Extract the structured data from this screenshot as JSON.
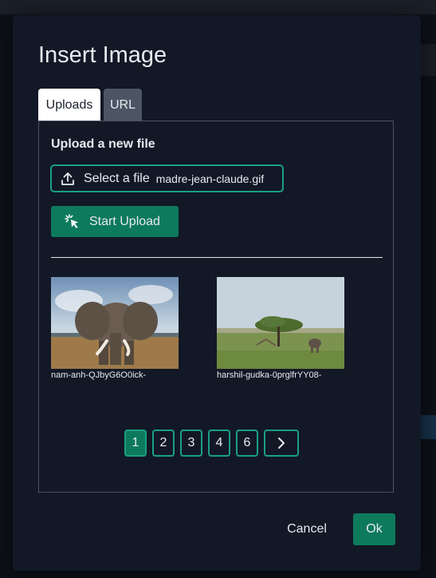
{
  "dialog": {
    "title": "Insert Image",
    "tabs": [
      {
        "label": "Uploads",
        "active": true
      },
      {
        "label": "URL",
        "active": false
      }
    ]
  },
  "uploads": {
    "section_label": "Upload a new file",
    "select_button_label": "Select a file",
    "selected_file": "madre-jean-claude.gif",
    "upload_button_label": "Start Upload",
    "images": [
      {
        "caption": "nam-anh-QJbyG6O0ick-",
        "subject": "elephant"
      },
      {
        "caption": "harshil-gudka-0prglfrYY08-",
        "subject": "savanna-tree-elephant"
      }
    ],
    "pagination": {
      "pages": [
        "1",
        "2",
        "3",
        "4",
        "6"
      ],
      "current": "1",
      "next_icon": "chevron-right-icon"
    }
  },
  "footer": {
    "cancel_label": "Cancel",
    "ok_label": "Ok"
  },
  "colors": {
    "dialog_bg": "#121826",
    "accent": "#0d7a5c",
    "accent_border": "#1aa083",
    "text": "#e7eaf0"
  }
}
